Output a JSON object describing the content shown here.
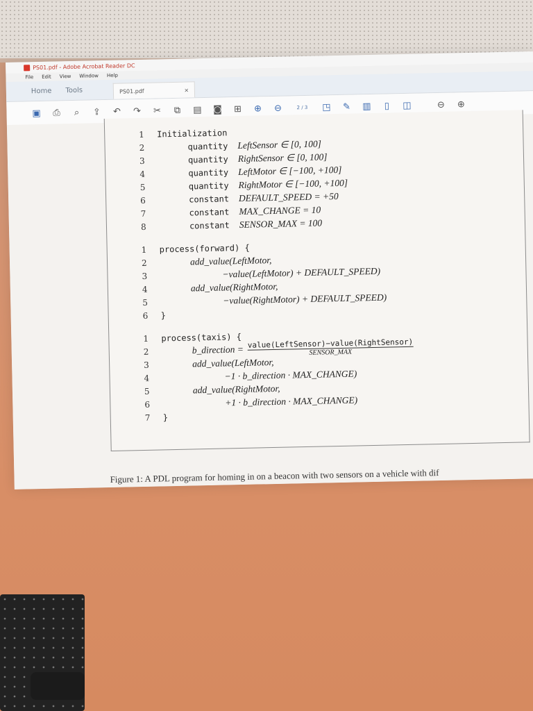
{
  "app": {
    "title": "PS01.pdf - Adobe Acrobat Reader DC"
  },
  "menu": [
    "File",
    "Edit",
    "View",
    "Window",
    "Help"
  ],
  "nav": {
    "home": "Home",
    "tools": "Tools",
    "doc_tab": "PS01.pdf",
    "close": "×"
  },
  "toolbar": {
    "page_indicator": "2 / 3"
  },
  "code": {
    "init": [
      {
        "n": "1",
        "kw": "Initialization",
        "rest": ""
      },
      {
        "n": "2",
        "kw": "quantity",
        "rest": "LeftSensor ∈ [0, 100]"
      },
      {
        "n": "3",
        "kw": "quantity",
        "rest": "RightSensor ∈ [0, 100]"
      },
      {
        "n": "4",
        "kw": "quantity",
        "rest": "LeftMotor ∈ [−100, +100]"
      },
      {
        "n": "5",
        "kw": "quantity",
        "rest": "RightMotor ∈ [−100, +100]"
      },
      {
        "n": "6",
        "kw": "constant",
        "rest": "DEFAULT_SPEED = +50"
      },
      {
        "n": "7",
        "kw": "constant",
        "rest": "MAX_CHANGE = 10"
      },
      {
        "n": "8",
        "kw": "constant",
        "rest": "SENSOR_MAX = 100"
      }
    ],
    "forward": [
      {
        "n": "1",
        "text": "process(forward) {"
      },
      {
        "n": "2",
        "text": "add_value(LeftMotor,"
      },
      {
        "n": "3",
        "text": "−value(LeftMotor) + DEFAULT_SPEED)"
      },
      {
        "n": "4",
        "text": "add_value(RightMotor,"
      },
      {
        "n": "5",
        "text": "−value(RightMotor) + DEFAULT_SPEED)"
      },
      {
        "n": "6",
        "text": "}"
      }
    ],
    "taxis": [
      {
        "n": "1",
        "text": "process(taxis) {"
      },
      {
        "n": "2",
        "text": "b_direction =",
        "frac_num": "value(LeftSensor)−value(RightSensor)",
        "frac_den": "SENSOR_MAX"
      },
      {
        "n": "3",
        "text": "add_value(LeftMotor,"
      },
      {
        "n": "4",
        "text": "−1 · b_direction · MAX_CHANGE)"
      },
      {
        "n": "5",
        "text": "add_value(RightMotor,"
      },
      {
        "n": "6",
        "text": "+1 · b_direction · MAX_CHANGE)"
      },
      {
        "n": "7",
        "text": "}"
      }
    ]
  },
  "caption": "Figure 1: A PDL program for homing in on a beacon with two sensors on a vehicle with dif"
}
